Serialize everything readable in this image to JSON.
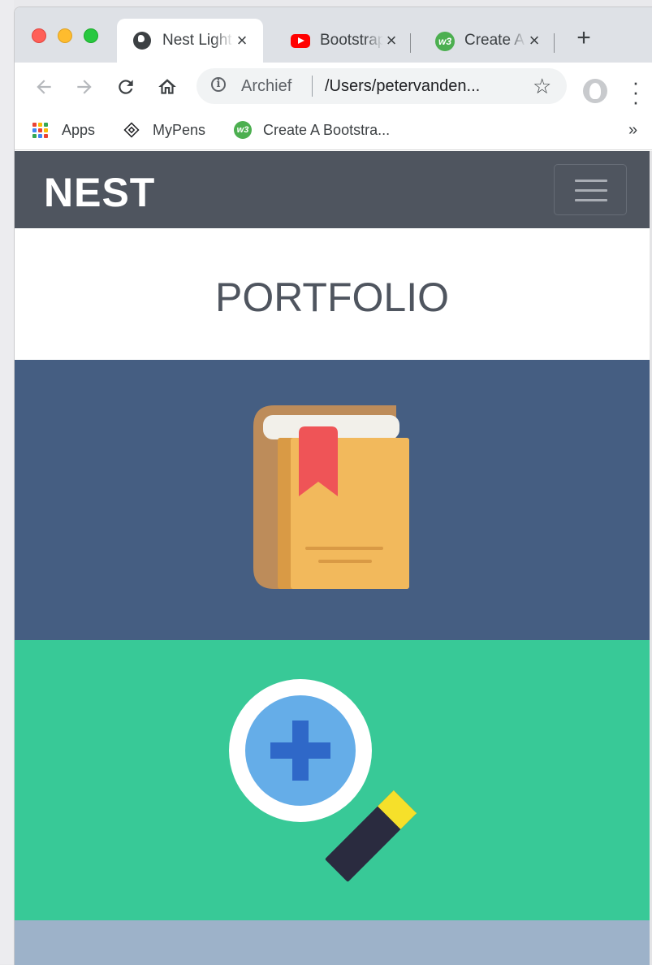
{
  "browser": {
    "tabs": [
      {
        "title": "Nest Light",
        "icon": "globe-icon",
        "active": true
      },
      {
        "title": "Bootstrap",
        "icon": "youtube-icon",
        "active": false
      },
      {
        "title": "Create A",
        "icon": "w3schools-icon",
        "active": false
      }
    ],
    "close_glyph": "×",
    "new_tab_glyph": "+",
    "omnibox": {
      "label": "Archief",
      "url": "/Users/petervanden..."
    },
    "bookmarks": [
      {
        "label": "Apps",
        "icon": "apps-grid-icon"
      },
      {
        "label": "MyPens",
        "icon": "codepen-icon"
      },
      {
        "label": "Create A Bootstra...",
        "icon": "w3schools-icon"
      }
    ],
    "bookmarks_overflow": "»"
  },
  "site": {
    "brand": "NEST",
    "heading": "PORTFOLIO",
    "colors": {
      "navbar": "#4f555f",
      "section_blue": "#455e82",
      "section_green": "#38c997",
      "section_gray": "#9db2c9"
    },
    "sections": [
      {
        "icon": "book-icon"
      },
      {
        "icon": "magnifier-plus-icon"
      }
    ]
  }
}
